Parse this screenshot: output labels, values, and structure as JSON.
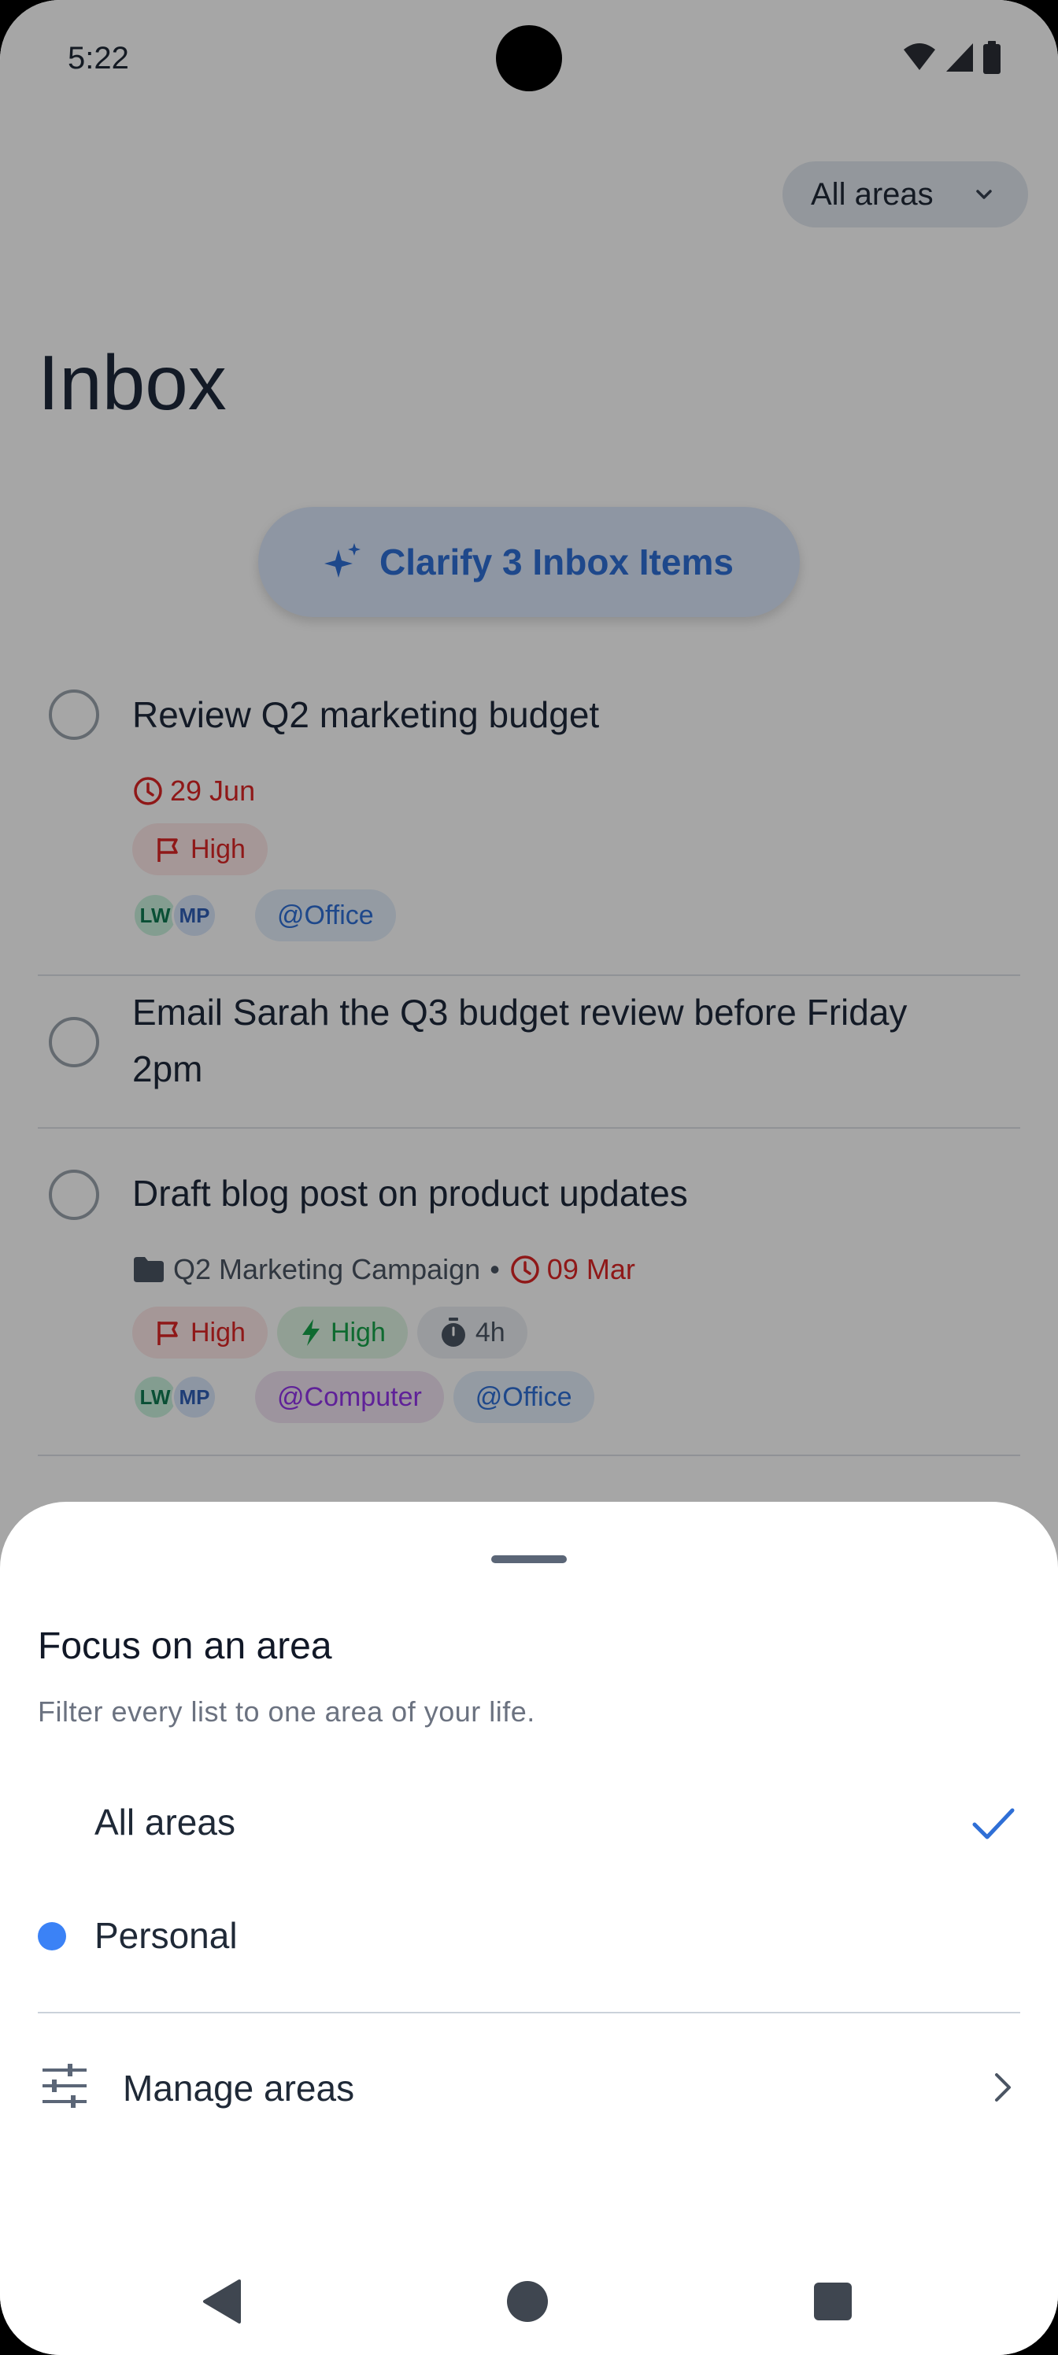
{
  "status_bar": {
    "time": "5:22"
  },
  "header": {
    "area_filter_label": "All areas",
    "title": "Inbox"
  },
  "clarify_button": {
    "label": "Clarify 3 Inbox Items"
  },
  "tasks": [
    {
      "title": "Review Q2 marketing budget",
      "due": "29 Jun",
      "priority": "High",
      "assignees": [
        "LW",
        "MP"
      ],
      "contexts": [
        "@Office"
      ]
    },
    {
      "title_line1": "Email Sarah the Q3 budget review before Friday",
      "title_line2": "2pm"
    },
    {
      "title": "Draft blog post on product updates",
      "project": "Q2 Marketing Campaign",
      "separator": "•",
      "due": "09 Mar",
      "priority": "High",
      "energy": "High",
      "duration": "4h",
      "assignees": [
        "LW",
        "MP"
      ],
      "contexts": [
        "@Computer",
        "@Office"
      ]
    }
  ],
  "sheet": {
    "title": "Focus on an area",
    "subtitle": "Filter every list to one area of your life.",
    "options": [
      {
        "label": "All areas",
        "selected": true
      },
      {
        "label": "Personal",
        "color": "#3b82f6",
        "selected": false
      }
    ],
    "manage_label": "Manage areas"
  },
  "colors": {
    "accent": "#2f6fd6",
    "danger": "#dc2626",
    "success": "#16a34a",
    "context_purple": "#9333ea",
    "area_personal": "#3b82f6"
  },
  "icons": {
    "status": [
      "wifi-icon",
      "signal-icon",
      "battery-icon"
    ],
    "nav": [
      "back-icon",
      "home-icon",
      "recents-icon"
    ]
  }
}
